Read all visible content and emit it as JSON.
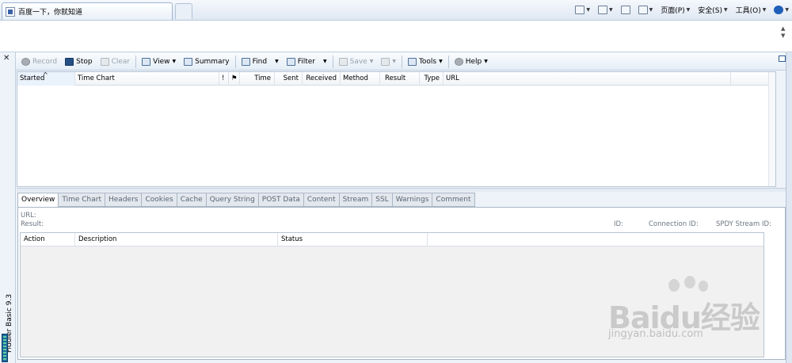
{
  "browser": {
    "tab_title": "百度一下，你就知道",
    "commands": [
      {
        "label": "",
        "icon": "home-icon",
        "caret": true
      },
      {
        "label": "",
        "icon": "rss-icon",
        "caret": true
      },
      {
        "label": "",
        "icon": "mail-icon",
        "caret": false
      },
      {
        "label": "",
        "icon": "print-icon",
        "caret": true
      },
      {
        "label": "页面(P)",
        "icon": "",
        "caret": true
      },
      {
        "label": "安全(S)",
        "icon": "",
        "caret": true
      },
      {
        "label": "工具(O)",
        "icon": "",
        "caret": true
      },
      {
        "label": "",
        "icon": "help-icon",
        "caret": true
      }
    ]
  },
  "fiddler": {
    "vertical_title": "Fiddler Basic 9.3",
    "toolbar": {
      "record": "Record",
      "stop": "Stop",
      "clear": "Clear",
      "view": "View",
      "summary": "Summary",
      "find": "Find",
      "filter": "Filter",
      "save": "Save",
      "tools": "Tools",
      "help": "Help"
    },
    "grid_columns": [
      "Started",
      "Time Chart",
      "!",
      "",
      "Time",
      "Sent",
      "Received",
      "Method",
      "Result",
      "Type",
      "URL"
    ],
    "tabs": [
      "Overview",
      "Time Chart",
      "Headers",
      "Cookies",
      "Cache",
      "Query String",
      "POST Data",
      "Content",
      "Stream",
      "SSL",
      "Warnings",
      "Comment"
    ],
    "overview": {
      "url_label": "URL:",
      "result_label": "Result:",
      "id_label": "ID:",
      "connection_label": "Connection ID:",
      "spdy_label": "SPDY Stream ID:"
    },
    "action_columns": [
      "Action",
      "Description",
      "Status"
    ]
  },
  "watermark": {
    "main": "Baidu经验",
    "sub": "jingyan.baidu.com"
  }
}
